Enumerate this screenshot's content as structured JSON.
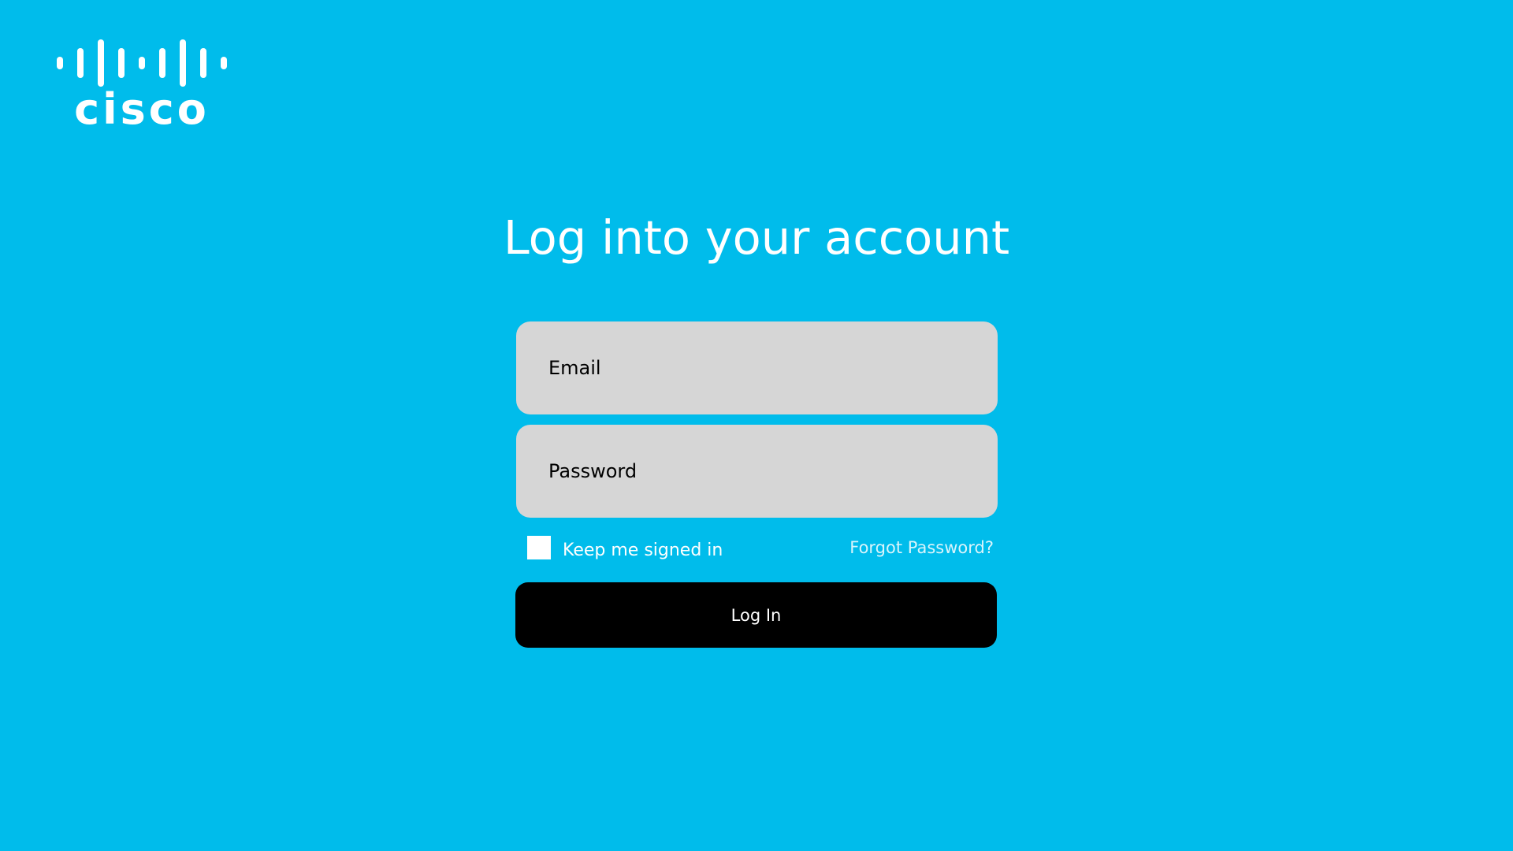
{
  "brand": {
    "name": "cisco",
    "logo_icon": "cisco-bridge-logo-icon",
    "color": "#ffffff"
  },
  "background_color": "#00bceb",
  "login": {
    "title": "Log into your account",
    "email_placeholder": "Email",
    "email_value": "",
    "password_placeholder": "Password",
    "password_value": "",
    "remember_label": "Keep me signed in",
    "remember_checked": false,
    "forgot_label": "Forgot Password?",
    "submit_label": "Log In",
    "submit_color": "#000000",
    "field_color": "#d6d6d6"
  }
}
